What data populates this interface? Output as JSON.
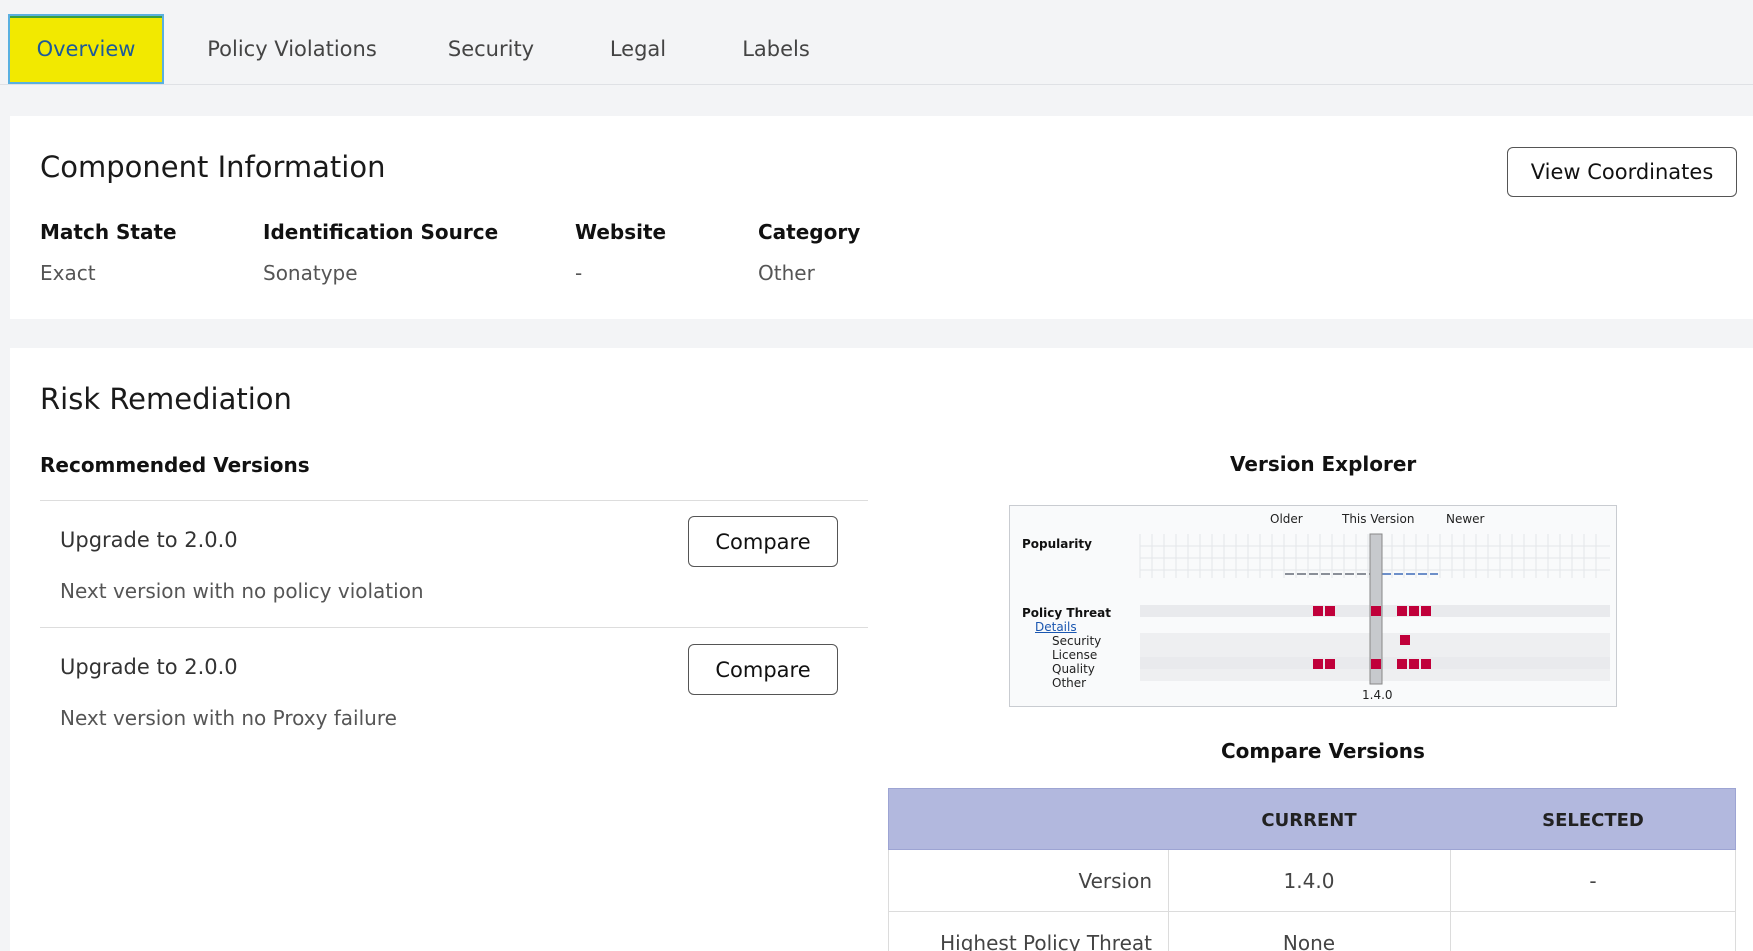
{
  "tabs": [
    {
      "label": "Overview",
      "active": true
    },
    {
      "label": "Policy Violations",
      "active": false
    },
    {
      "label": "Security",
      "active": false
    },
    {
      "label": "Legal",
      "active": false
    },
    {
      "label": "Labels",
      "active": false
    }
  ],
  "component_info": {
    "title": "Component Information",
    "view_coordinates_label": "View Coordinates",
    "fields": [
      {
        "label": "Match State",
        "value": "Exact"
      },
      {
        "label": "Identification Source",
        "value": "Sonatype"
      },
      {
        "label": "Website",
        "value": "-"
      },
      {
        "label": "Category",
        "value": "Other"
      }
    ]
  },
  "risk_remediation": {
    "title": "Risk Remediation",
    "recommended_title": "Recommended Versions",
    "recommendations": [
      {
        "title": "Upgrade to 2.0.0",
        "subtitle": "Next version with no policy violation",
        "button": "Compare"
      },
      {
        "title": "Upgrade to 2.0.0",
        "subtitle": "Next version with no Proxy failure",
        "button": "Compare"
      }
    ]
  },
  "version_explorer": {
    "title": "Version Explorer",
    "older": "Older",
    "this_version": "This Version",
    "newer": "Newer",
    "popularity": "Popularity",
    "policy_threat": "Policy Threat",
    "details_link": "Details",
    "categories": [
      "Security",
      "License",
      "Quality",
      "Other"
    ],
    "version": "1.4.0",
    "threat_color": "#c0003a"
  },
  "compare_versions": {
    "title": "Compare Versions",
    "headers": [
      "",
      "CURRENT",
      "SELECTED"
    ],
    "rows": [
      {
        "label": "Version",
        "current": "1.4.0",
        "selected": "-"
      },
      {
        "label": "Highest Policy Threat",
        "current": "None",
        "selected": ""
      }
    ]
  },
  "colors": {
    "active_tab_bg": "#f2e900",
    "table_header_bg": "#b2b8de"
  }
}
